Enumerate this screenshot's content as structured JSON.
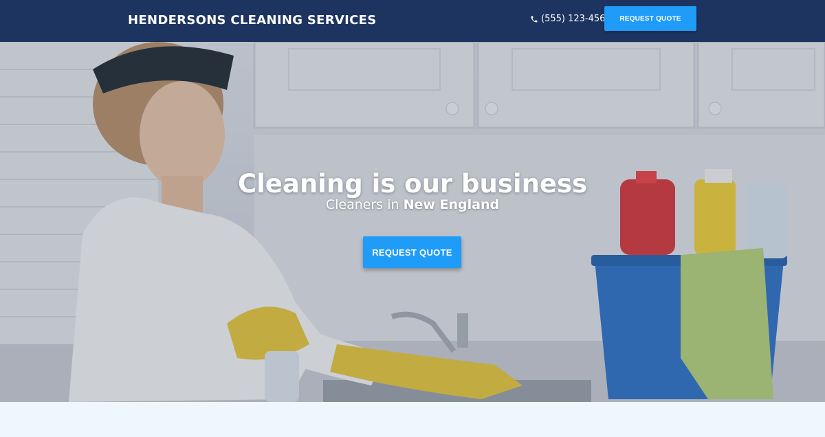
{
  "header": {
    "brand": "HENDERSONS CLEANING SERVICES",
    "phone": "(555) 123-4567",
    "cta_label": "REQUEST QUOTE"
  },
  "hero": {
    "title": "Cleaning is our business",
    "subtitle_prefix": "Cleaners in ",
    "subtitle_location": "New England",
    "cta_label": "REQUEST QUOTE",
    "image_description_icon": "cleaning-woman-photo"
  },
  "colors": {
    "header_bg": "#1d3461",
    "accent": "#1e9cf7",
    "below_bg": "#eef8fc"
  }
}
